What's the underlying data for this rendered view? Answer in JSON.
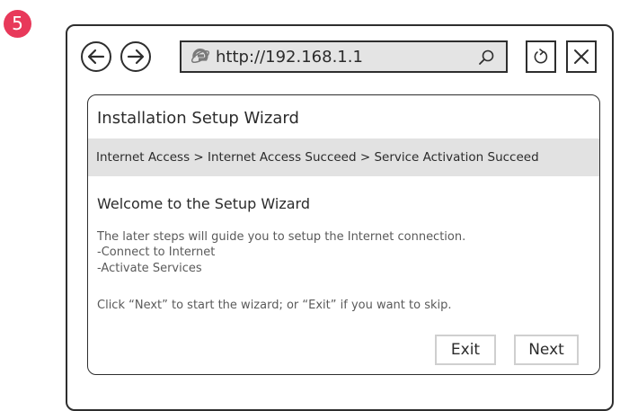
{
  "step_number": "5",
  "browser": {
    "url": "http://192.168.1.1"
  },
  "wizard": {
    "title": "Installation Setup Wizard",
    "breadcrumb": "Internet Access > Internet Access Succeed > Service Activation Succeed",
    "welcome": "Welcome to the Setup Wizard",
    "lines": [
      "The later steps will guide you to setup the Internet connection.",
      "-Connect to Internet",
      "-Activate Services",
      "Click “Next” to start the wizard; or “Exit” if you want to skip."
    ],
    "exit_label": "Exit",
    "next_label": "Next"
  },
  "colors": {
    "badge": "#e8395a",
    "ie_icon": "#7a7a7a",
    "breadcrumb_bg": "#e2e2e2",
    "address_bg": "#e4e4e4"
  },
  "icons": [
    "back-arrow-icon",
    "forward-arrow-icon",
    "internet-explorer-icon",
    "search-icon",
    "refresh-icon",
    "close-icon"
  ]
}
